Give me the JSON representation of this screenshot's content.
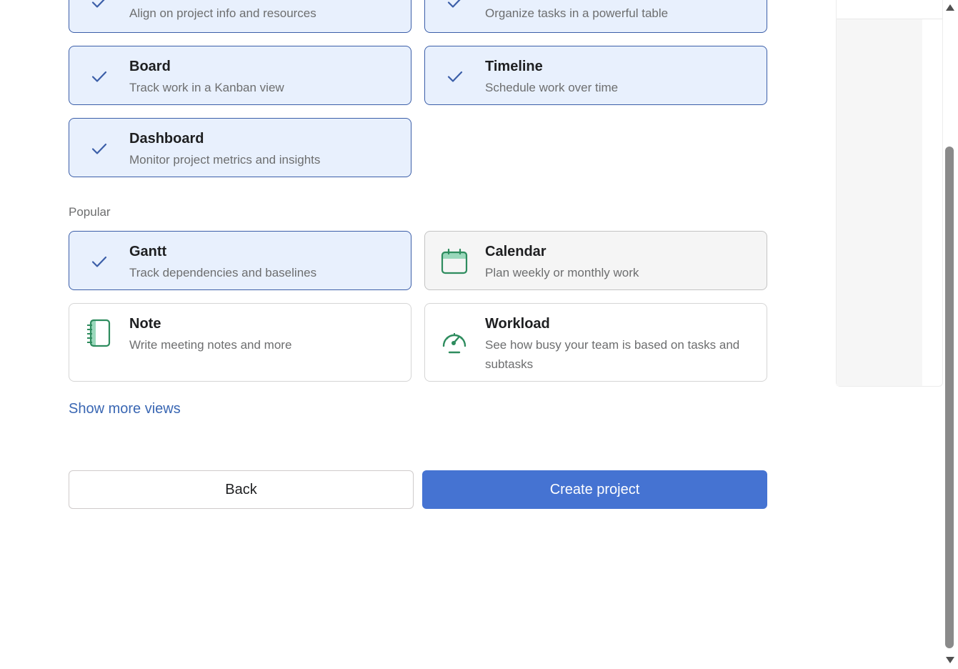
{
  "views": {
    "row0": [
      {
        "title": "",
        "description": "Align on project info and resources",
        "state": "selected",
        "icon": "check-icon"
      },
      {
        "title": "",
        "description": "Organize tasks in a powerful table",
        "state": "selected",
        "icon": "check-icon"
      }
    ],
    "row1": [
      {
        "title": "Board",
        "description": "Track work in a Kanban view",
        "state": "selected",
        "icon": "check-icon"
      },
      {
        "title": "Timeline",
        "description": "Schedule work over time",
        "state": "selected",
        "icon": "check-icon"
      }
    ],
    "row2": [
      {
        "title": "Dashboard",
        "description": "Monitor project metrics and insights",
        "state": "selected",
        "icon": "check-icon"
      }
    ]
  },
  "popular": {
    "label": "Popular",
    "items": [
      {
        "title": "Gantt",
        "description": "Track dependencies and baselines",
        "state": "selected",
        "icon": "check-icon"
      },
      {
        "title": "Calendar",
        "description": "Plan weekly or monthly work",
        "state": "hovered",
        "icon": "calendar-icon"
      },
      {
        "title": "Note",
        "description": "Write meeting notes and more",
        "state": "unselected",
        "icon": "notebook-icon"
      },
      {
        "title": "Workload",
        "description": "See how busy your team is based on tasks and subtasks",
        "state": "unselected",
        "icon": "gauge-icon"
      }
    ]
  },
  "show_more_label": "Show more views",
  "buttons": {
    "back": "Back",
    "create": "Create project"
  },
  "colors": {
    "accent": "#4573d2",
    "selected_bg": "#e8f0fd",
    "selected_border": "#3b5ea8",
    "icon_green": "#2e8c5e",
    "icon_green_light": "#9ad8bb",
    "link": "#3a67b3"
  }
}
